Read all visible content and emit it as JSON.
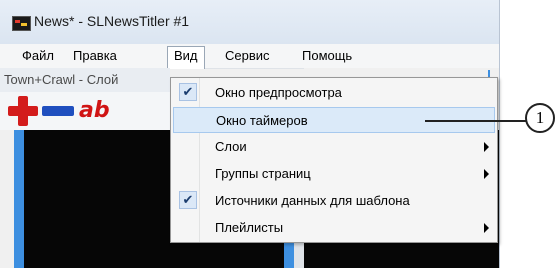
{
  "window": {
    "title": "News* - SLNewsTitler #1"
  },
  "menubar": {
    "items": [
      {
        "label": "Файл"
      },
      {
        "label": "Правка"
      },
      {
        "label": "Вид"
      },
      {
        "label": "Сервис"
      },
      {
        "label": "Помощь"
      }
    ],
    "active": "Вид"
  },
  "doc_tab": {
    "label": "Town+Crawl - Слой"
  },
  "toolbar": {
    "icons": [
      "add-icon",
      "remove-icon",
      "text-icon"
    ],
    "text_icon_label": "ab"
  },
  "view_menu": {
    "items": [
      {
        "label": "Окно предпросмотра",
        "checked": true,
        "submenu": false,
        "highlighted": false
      },
      {
        "label": "Окно таймеров",
        "checked": false,
        "submenu": false,
        "highlighted": true
      },
      {
        "label": "Слои",
        "checked": false,
        "submenu": true,
        "highlighted": false
      },
      {
        "label": "Группы страниц",
        "checked": false,
        "submenu": true,
        "highlighted": false
      },
      {
        "label": "Источники данных для шаблона",
        "checked": true,
        "submenu": false,
        "highlighted": false
      },
      {
        "label": "Плейлисты",
        "checked": false,
        "submenu": true,
        "highlighted": false
      }
    ],
    "check_glyph": "✔"
  },
  "callout": {
    "number": "1"
  },
  "colors": {
    "highlight": "#dbeaf9",
    "accent_blue": "#3d8fe0",
    "red": "#d31c1c"
  }
}
